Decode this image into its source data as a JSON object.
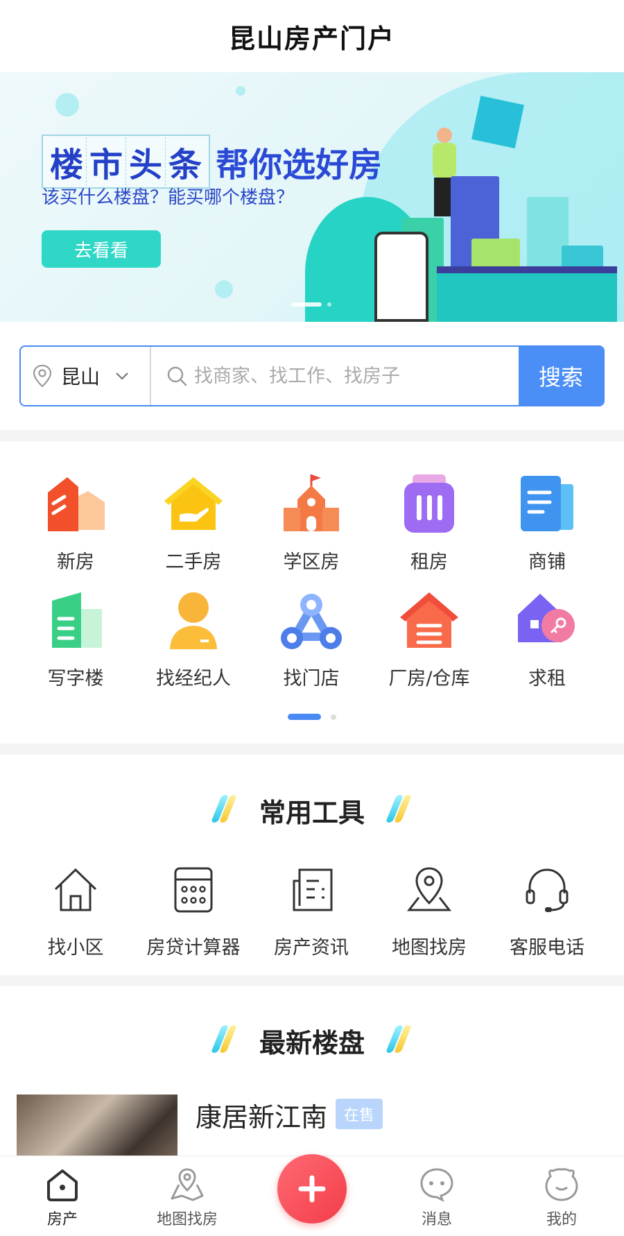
{
  "header": {
    "title": "昆山房产门户"
  },
  "banner": {
    "title_boxed": [
      "楼",
      "市",
      "头",
      "条"
    ],
    "title_rest": "帮你选好房",
    "subtitle": "该买什么楼盘？能买哪个楼盘？",
    "button": "去看看"
  },
  "search": {
    "location_icon": "location-pin-icon",
    "city": "昆山",
    "placeholder": "找商家、找工作、找房子",
    "button": "搜索"
  },
  "categories": [
    {
      "label": "新房",
      "icon": "new-house-icon"
    },
    {
      "label": "二手房",
      "icon": "second-hand-house-icon"
    },
    {
      "label": "学区房",
      "icon": "school-district-icon"
    },
    {
      "label": "租房",
      "icon": "rental-icon"
    },
    {
      "label": "商铺",
      "icon": "shop-icon"
    },
    {
      "label": "写字楼",
      "icon": "office-building-icon"
    },
    {
      "label": "找经纪人",
      "icon": "agent-icon"
    },
    {
      "label": "找门店",
      "icon": "store-icon"
    },
    {
      "label": "厂房/仓库",
      "icon": "warehouse-icon"
    },
    {
      "label": "求租",
      "icon": "seek-rent-icon"
    }
  ],
  "tools": {
    "title": "常用工具",
    "items": [
      {
        "label": "找小区",
        "icon": "house-outline-icon"
      },
      {
        "label": "房贷计算器",
        "icon": "calculator-icon"
      },
      {
        "label": "房产资讯",
        "icon": "news-icon"
      },
      {
        "label": "地图找房",
        "icon": "map-pin-icon"
      },
      {
        "label": "客服电话",
        "icon": "headset-icon"
      }
    ]
  },
  "newest": {
    "title": "最新楼盘",
    "items": [
      {
        "name": "康居新江南",
        "badge": "在售"
      }
    ]
  },
  "tabbar": {
    "items": [
      {
        "label": "房产",
        "icon": "home-tab-icon"
      },
      {
        "label": "地图找房",
        "icon": "map-tab-icon"
      },
      {
        "label": "消息",
        "icon": "message-tab-icon"
      },
      {
        "label": "我的",
        "icon": "profile-tab-icon"
      }
    ],
    "fab_icon": "plus-icon"
  },
  "colors": {
    "primary": "#4b8ff6",
    "fab": "#f33d4a",
    "banner_button": "#2fd7c7"
  }
}
